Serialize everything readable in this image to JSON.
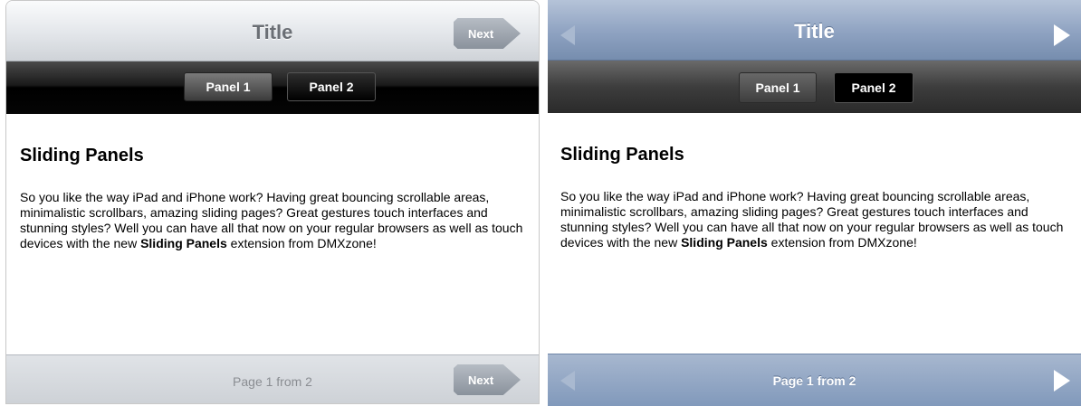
{
  "panel_a": {
    "header": {
      "title": "Title",
      "next_label": "Next"
    },
    "tabs": [
      {
        "label": "Panel 1"
      },
      {
        "label": "Panel 2"
      }
    ],
    "content": {
      "heading": "Sliding Panels",
      "text_before": "So you like the way iPad and iPhone work? Having great bouncing scrollable areas, minimalistic scrollbars, amazing sliding pages? Great gestures touch interfaces and stunning styles? Well you can have all that now on your regular browsers as well as touch devices with the new ",
      "bold_text": "Sliding Panels",
      "text_after": " extension from DMXzone!"
    },
    "footer": {
      "page_text": "Page 1 from 2",
      "next_label": "Next"
    }
  },
  "panel_b": {
    "header": {
      "title": "Title",
      "prev_icon": "arrow-left-icon",
      "next_icon": "arrow-right-icon"
    },
    "tabs": [
      {
        "label": "Panel 1"
      },
      {
        "label": "Panel 2"
      }
    ],
    "content": {
      "heading": "Sliding Panels",
      "text_before": "So you like the way iPad and iPhone work? Having great bouncing scrollable areas, minimalistic scrollbars, amazing sliding pages? Great gestures touch interfaces and stunning styles? Well you can have all that now on your regular browsers as well as touch devices with the new ",
      "bold_text": "Sliding Panels",
      "text_after": " extension from DMXzone!"
    },
    "footer": {
      "page_text": "Page 1 from 2",
      "prev_icon": "arrow-left-icon",
      "next_icon": "arrow-right-icon"
    }
  },
  "colors": {
    "panel_a_tabbar": "#000000",
    "panel_b_header": "#8ea2c1",
    "panel_b_footer": "#8199bb"
  }
}
